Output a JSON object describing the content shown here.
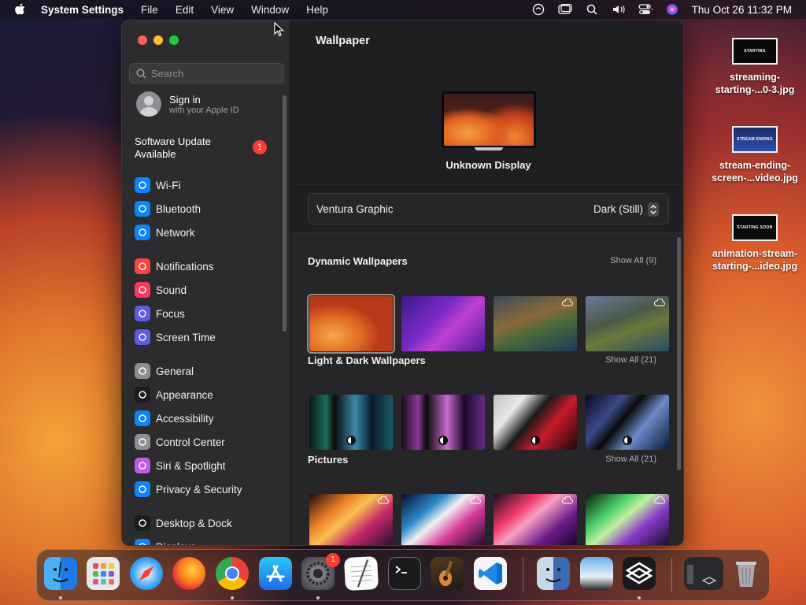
{
  "menubar": {
    "app_name": "System Settings",
    "items": [
      "File",
      "Edit",
      "View",
      "Window",
      "Help"
    ],
    "clock": "Thu Oct 26  11:32 PM"
  },
  "sidebar": {
    "search_placeholder": "Search",
    "signin_title": "Sign in",
    "signin_subtitle": "with your Apple ID",
    "software_update_line1": "Software Update",
    "software_update_line2": "Available",
    "software_update_badge": "1",
    "items": [
      {
        "label": "Wi-Fi",
        "icon": "wifi-icon",
        "color": "#0a84ff"
      },
      {
        "label": "Bluetooth",
        "icon": "bluetooth-icon",
        "color": "#0a84ff"
      },
      {
        "label": "Network",
        "icon": "globe-icon",
        "color": "#0a84ff"
      },
      {
        "label": "Notifications",
        "icon": "bell-icon",
        "color": "#ff453a"
      },
      {
        "label": "Sound",
        "icon": "speaker-icon",
        "color": "#ff375f"
      },
      {
        "label": "Focus",
        "icon": "moon-icon",
        "color": "#5e5ce6"
      },
      {
        "label": "Screen Time",
        "icon": "hourglass-icon",
        "color": "#5e5ce6"
      },
      {
        "label": "General",
        "icon": "gear-icon",
        "color": "#8e8e93"
      },
      {
        "label": "Appearance",
        "icon": "appearance-icon",
        "color": "#1c1c1e"
      },
      {
        "label": "Accessibility",
        "icon": "accessibility-icon",
        "color": "#0a84ff"
      },
      {
        "label": "Control Center",
        "icon": "toggles-icon",
        "color": "#8e8e93"
      },
      {
        "label": "Siri & Spotlight",
        "icon": "siri-icon",
        "color": "#bf5af2"
      },
      {
        "label": "Privacy & Security",
        "icon": "hand-icon",
        "color": "#0a84ff"
      },
      {
        "label": "Desktop & Dock",
        "icon": "dock-icon",
        "color": "#1c1c1e"
      },
      {
        "label": "Displays",
        "icon": "display-icon",
        "color": "#0a84ff"
      }
    ]
  },
  "main": {
    "title": "Wallpaper",
    "display_name": "Unknown Display",
    "wallpaper_name": "Ventura Graphic",
    "wallpaper_mode": "Dark (Still)",
    "sections": [
      {
        "title": "Dynamic Wallpapers",
        "show_all": "Show All (9)"
      },
      {
        "title": "Light & Dark Wallpapers",
        "show_all": "Show All (21)"
      },
      {
        "title": "Pictures",
        "show_all": "Show All (21)"
      }
    ]
  },
  "desktop": {
    "files": [
      {
        "line1": "streaming-",
        "line2": "starting-...0-3.jpg",
        "thumb_text": "STARTING"
      },
      {
        "line1": "stream-ending-",
        "line2": "screen-...video.jpg",
        "thumb_text": "STREAM ENDING"
      },
      {
        "line1": "animation-stream-",
        "line2": "starting-...ideo.jpg",
        "thumb_text": "STARTING SOON"
      }
    ]
  },
  "dock": {
    "settings_badge": "1",
    "apps": [
      "finder-icon",
      "launchpad-icon",
      "safari-icon",
      "firefox-icon",
      "chrome-icon",
      "app-store-icon",
      "system-settings-icon",
      "textedit-icon",
      "terminal-icon",
      "garageband-icon",
      "vscode-icon",
      "finder-alt-icon",
      "preview-icon",
      "stream-app-icon",
      "screen-recorder-icon",
      "trash-icon"
    ]
  }
}
